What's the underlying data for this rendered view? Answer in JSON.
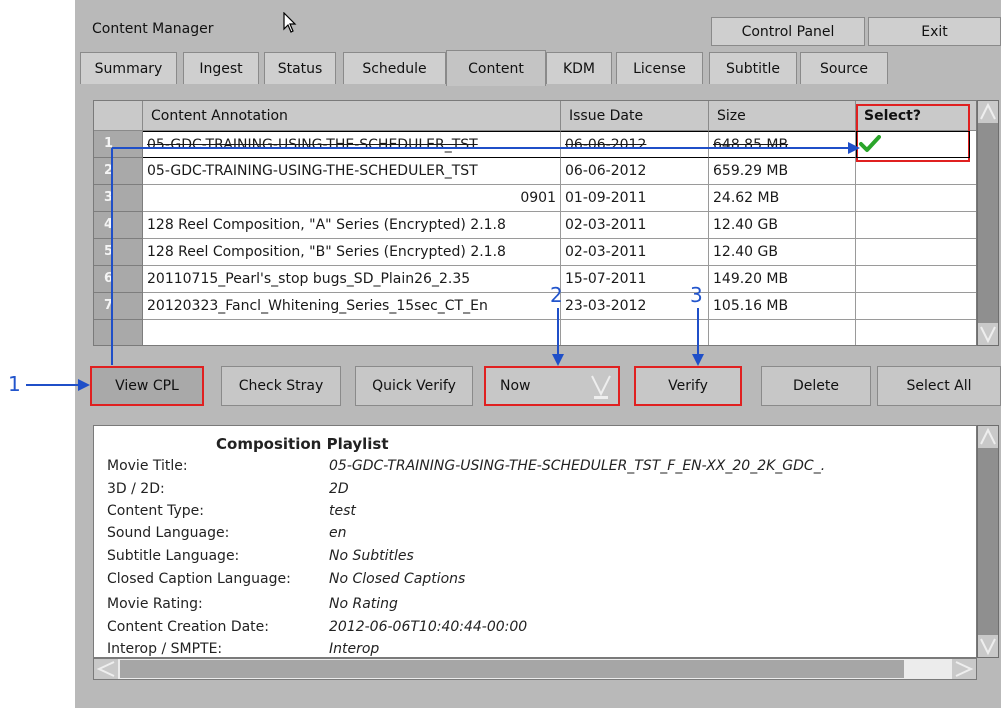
{
  "app": {
    "title": "Content Manager"
  },
  "header": {
    "control_panel": "Control Panel",
    "exit": "Exit"
  },
  "tabs": [
    "Summary",
    "Ingest",
    "Status",
    "Schedule",
    "Content",
    "KDM",
    "License",
    "Subtitle",
    "Source"
  ],
  "active_tab": "Content",
  "table": {
    "columns": [
      "Content Annotation",
      "Issue Date",
      "Size",
      "Select?"
    ],
    "rows": [
      {
        "num": "1",
        "annotation": "05-GDC-TRAINING-USING-THE-SCHEDULER_TST",
        "date": "06-06-2012",
        "size": "648.85 MB",
        "selected": true
      },
      {
        "num": "2",
        "annotation": "05-GDC-TRAINING-USING-THE-SCHEDULER_TST",
        "date": "06-06-2012",
        "size": "659.29 MB",
        "selected": false
      },
      {
        "num": "3",
        "annotation": "0901",
        "date": "01-09-2011",
        "size": "24.62 MB",
        "selected": false
      },
      {
        "num": "4",
        "annotation": "128 Reel Composition, \"A\" Series (Encrypted) 2.1.8",
        "date": "02-03-2011",
        "size": "12.40 GB",
        "selected": false
      },
      {
        "num": "5",
        "annotation": "128 Reel Composition, \"B\" Series (Encrypted) 2.1.8",
        "date": "02-03-2011",
        "size": "12.40 GB",
        "selected": false
      },
      {
        "num": "6",
        "annotation": "20110715_Pearl's_stop bugs_SD_Plain26_2.35",
        "date": "15-07-2011",
        "size": "149.20 MB",
        "selected": false
      },
      {
        "num": "7",
        "annotation": "20120323_Fancl_Whitening_Series_15sec_CT_En",
        "date": "23-03-2012",
        "size": "105.16 MB",
        "selected": false
      }
    ]
  },
  "actions": {
    "view_cpl": "View CPL",
    "check_stray": "Check Stray",
    "quick_verify": "Quick Verify",
    "schedule_select": "Now",
    "verify": "Verify",
    "delete": "Delete",
    "select_all": "Select All"
  },
  "cpl": {
    "heading": "Composition Playlist",
    "fields": [
      {
        "label": "Movie Title:",
        "value": "05-GDC-TRAINING-USING-THE-SCHEDULER_TST_F_EN-XX_20_2K_GDC_."
      },
      {
        "label": "3D / 2D:",
        "value": "2D"
      },
      {
        "label": "Content Type:",
        "value": "test"
      },
      {
        "label": "Sound Language:",
        "value": "en"
      },
      {
        "label": "Subtitle Language:",
        "value": "No Subtitles"
      },
      {
        "label": "Closed Caption Language:",
        "value": "No Closed Captions"
      },
      {
        "label": "Movie Rating:",
        "value": "No Rating"
      },
      {
        "label": "Content Creation Date:",
        "value": "2012-06-06T10:40:44-00:00"
      },
      {
        "label": "Interop / SMPTE:",
        "value": "Interop"
      }
    ]
  },
  "annotations": {
    "a1": "1",
    "a2": "2",
    "a3": "3"
  },
  "colors": {
    "highlight": "#e02020",
    "annotation": "#1f4fc8",
    "check": "#2aa52a"
  }
}
